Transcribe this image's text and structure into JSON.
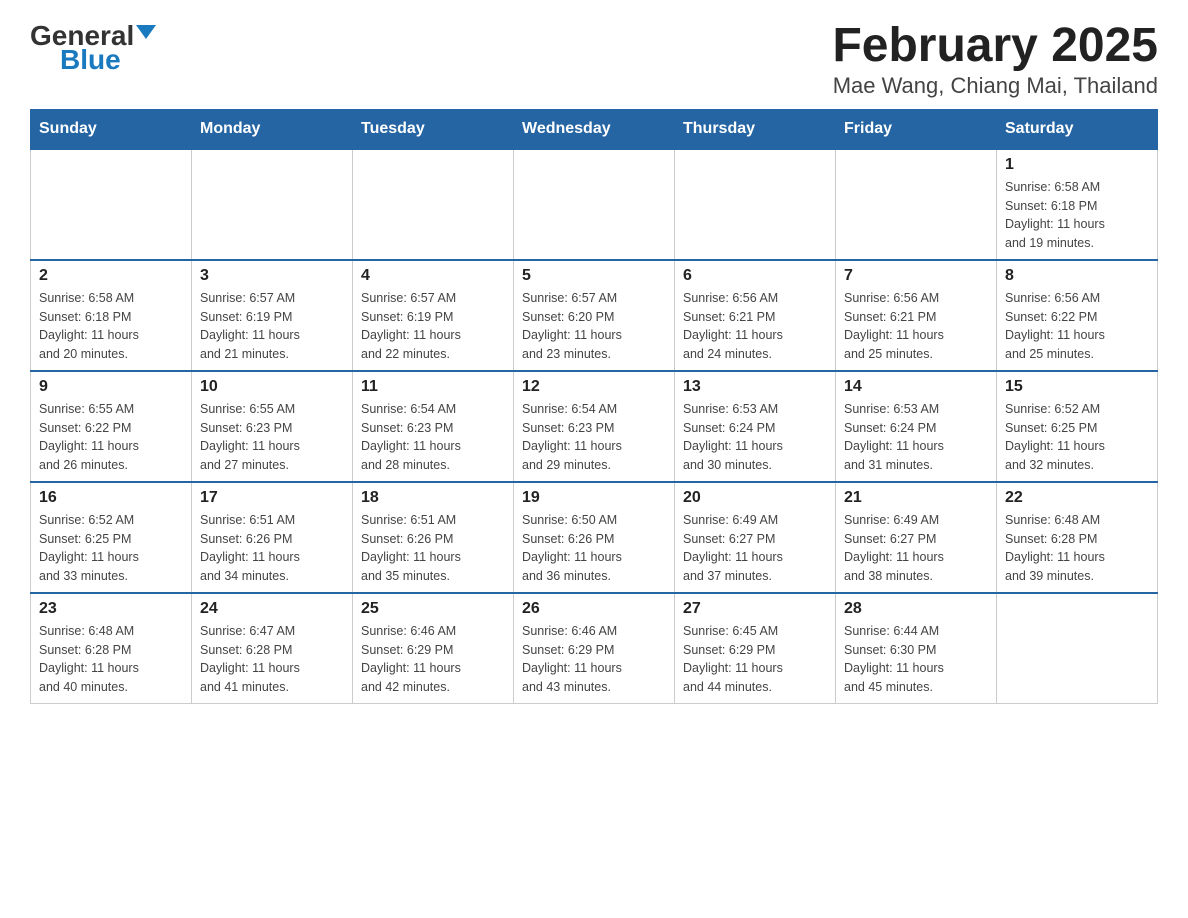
{
  "logo": {
    "general": "General",
    "blue": "Blue"
  },
  "title": "February 2025",
  "subtitle": "Mae Wang, Chiang Mai, Thailand",
  "days_of_week": [
    "Sunday",
    "Monday",
    "Tuesday",
    "Wednesday",
    "Thursday",
    "Friday",
    "Saturday"
  ],
  "weeks": [
    [
      {
        "day": "",
        "info": ""
      },
      {
        "day": "",
        "info": ""
      },
      {
        "day": "",
        "info": ""
      },
      {
        "day": "",
        "info": ""
      },
      {
        "day": "",
        "info": ""
      },
      {
        "day": "",
        "info": ""
      },
      {
        "day": "1",
        "info": "Sunrise: 6:58 AM\nSunset: 6:18 PM\nDaylight: 11 hours\nand 19 minutes."
      }
    ],
    [
      {
        "day": "2",
        "info": "Sunrise: 6:58 AM\nSunset: 6:18 PM\nDaylight: 11 hours\nand 20 minutes."
      },
      {
        "day": "3",
        "info": "Sunrise: 6:57 AM\nSunset: 6:19 PM\nDaylight: 11 hours\nand 21 minutes."
      },
      {
        "day": "4",
        "info": "Sunrise: 6:57 AM\nSunset: 6:19 PM\nDaylight: 11 hours\nand 22 minutes."
      },
      {
        "day": "5",
        "info": "Sunrise: 6:57 AM\nSunset: 6:20 PM\nDaylight: 11 hours\nand 23 minutes."
      },
      {
        "day": "6",
        "info": "Sunrise: 6:56 AM\nSunset: 6:21 PM\nDaylight: 11 hours\nand 24 minutes."
      },
      {
        "day": "7",
        "info": "Sunrise: 6:56 AM\nSunset: 6:21 PM\nDaylight: 11 hours\nand 25 minutes."
      },
      {
        "day": "8",
        "info": "Sunrise: 6:56 AM\nSunset: 6:22 PM\nDaylight: 11 hours\nand 25 minutes."
      }
    ],
    [
      {
        "day": "9",
        "info": "Sunrise: 6:55 AM\nSunset: 6:22 PM\nDaylight: 11 hours\nand 26 minutes."
      },
      {
        "day": "10",
        "info": "Sunrise: 6:55 AM\nSunset: 6:23 PM\nDaylight: 11 hours\nand 27 minutes."
      },
      {
        "day": "11",
        "info": "Sunrise: 6:54 AM\nSunset: 6:23 PM\nDaylight: 11 hours\nand 28 minutes."
      },
      {
        "day": "12",
        "info": "Sunrise: 6:54 AM\nSunset: 6:23 PM\nDaylight: 11 hours\nand 29 minutes."
      },
      {
        "day": "13",
        "info": "Sunrise: 6:53 AM\nSunset: 6:24 PM\nDaylight: 11 hours\nand 30 minutes."
      },
      {
        "day": "14",
        "info": "Sunrise: 6:53 AM\nSunset: 6:24 PM\nDaylight: 11 hours\nand 31 minutes."
      },
      {
        "day": "15",
        "info": "Sunrise: 6:52 AM\nSunset: 6:25 PM\nDaylight: 11 hours\nand 32 minutes."
      }
    ],
    [
      {
        "day": "16",
        "info": "Sunrise: 6:52 AM\nSunset: 6:25 PM\nDaylight: 11 hours\nand 33 minutes."
      },
      {
        "day": "17",
        "info": "Sunrise: 6:51 AM\nSunset: 6:26 PM\nDaylight: 11 hours\nand 34 minutes."
      },
      {
        "day": "18",
        "info": "Sunrise: 6:51 AM\nSunset: 6:26 PM\nDaylight: 11 hours\nand 35 minutes."
      },
      {
        "day": "19",
        "info": "Sunrise: 6:50 AM\nSunset: 6:26 PM\nDaylight: 11 hours\nand 36 minutes."
      },
      {
        "day": "20",
        "info": "Sunrise: 6:49 AM\nSunset: 6:27 PM\nDaylight: 11 hours\nand 37 minutes."
      },
      {
        "day": "21",
        "info": "Sunrise: 6:49 AM\nSunset: 6:27 PM\nDaylight: 11 hours\nand 38 minutes."
      },
      {
        "day": "22",
        "info": "Sunrise: 6:48 AM\nSunset: 6:28 PM\nDaylight: 11 hours\nand 39 minutes."
      }
    ],
    [
      {
        "day": "23",
        "info": "Sunrise: 6:48 AM\nSunset: 6:28 PM\nDaylight: 11 hours\nand 40 minutes."
      },
      {
        "day": "24",
        "info": "Sunrise: 6:47 AM\nSunset: 6:28 PM\nDaylight: 11 hours\nand 41 minutes."
      },
      {
        "day": "25",
        "info": "Sunrise: 6:46 AM\nSunset: 6:29 PM\nDaylight: 11 hours\nand 42 minutes."
      },
      {
        "day": "26",
        "info": "Sunrise: 6:46 AM\nSunset: 6:29 PM\nDaylight: 11 hours\nand 43 minutes."
      },
      {
        "day": "27",
        "info": "Sunrise: 6:45 AM\nSunset: 6:29 PM\nDaylight: 11 hours\nand 44 minutes."
      },
      {
        "day": "28",
        "info": "Sunrise: 6:44 AM\nSunset: 6:30 PM\nDaylight: 11 hours\nand 45 minutes."
      },
      {
        "day": "",
        "info": ""
      }
    ]
  ]
}
